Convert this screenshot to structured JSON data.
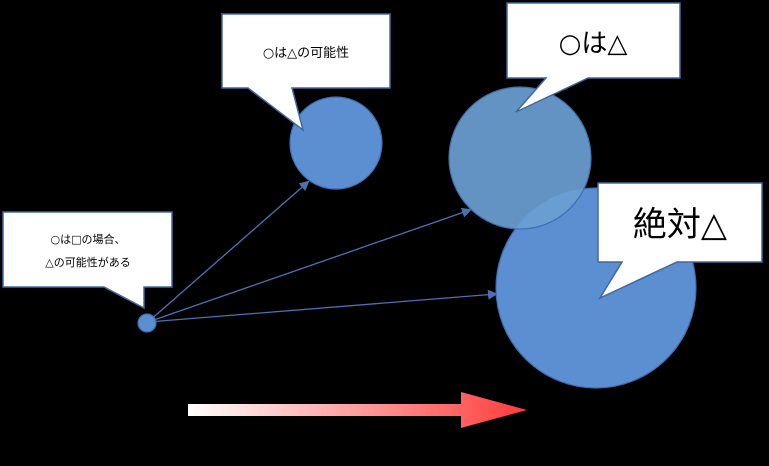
{
  "colors": {
    "background": "#000000",
    "circle_fill": "#5b8fd1",
    "circle_fill_overlap": "#6aa0d3",
    "circle_stroke": "#3f6fae",
    "arrow_line": "#4a72b3",
    "callout_fill": "#ffffff",
    "callout_stroke": "#41689f",
    "gradient_start": "#ffffff",
    "gradient_end": "#ff3b3b"
  },
  "callouts": {
    "source": {
      "line1": "○は□の場合、",
      "line2": "△の可能性がある"
    },
    "possible": {
      "text": "○は△の可能性"
    },
    "likely": {
      "text": "○は△"
    },
    "absolute": {
      "text": "絶対△"
    }
  }
}
